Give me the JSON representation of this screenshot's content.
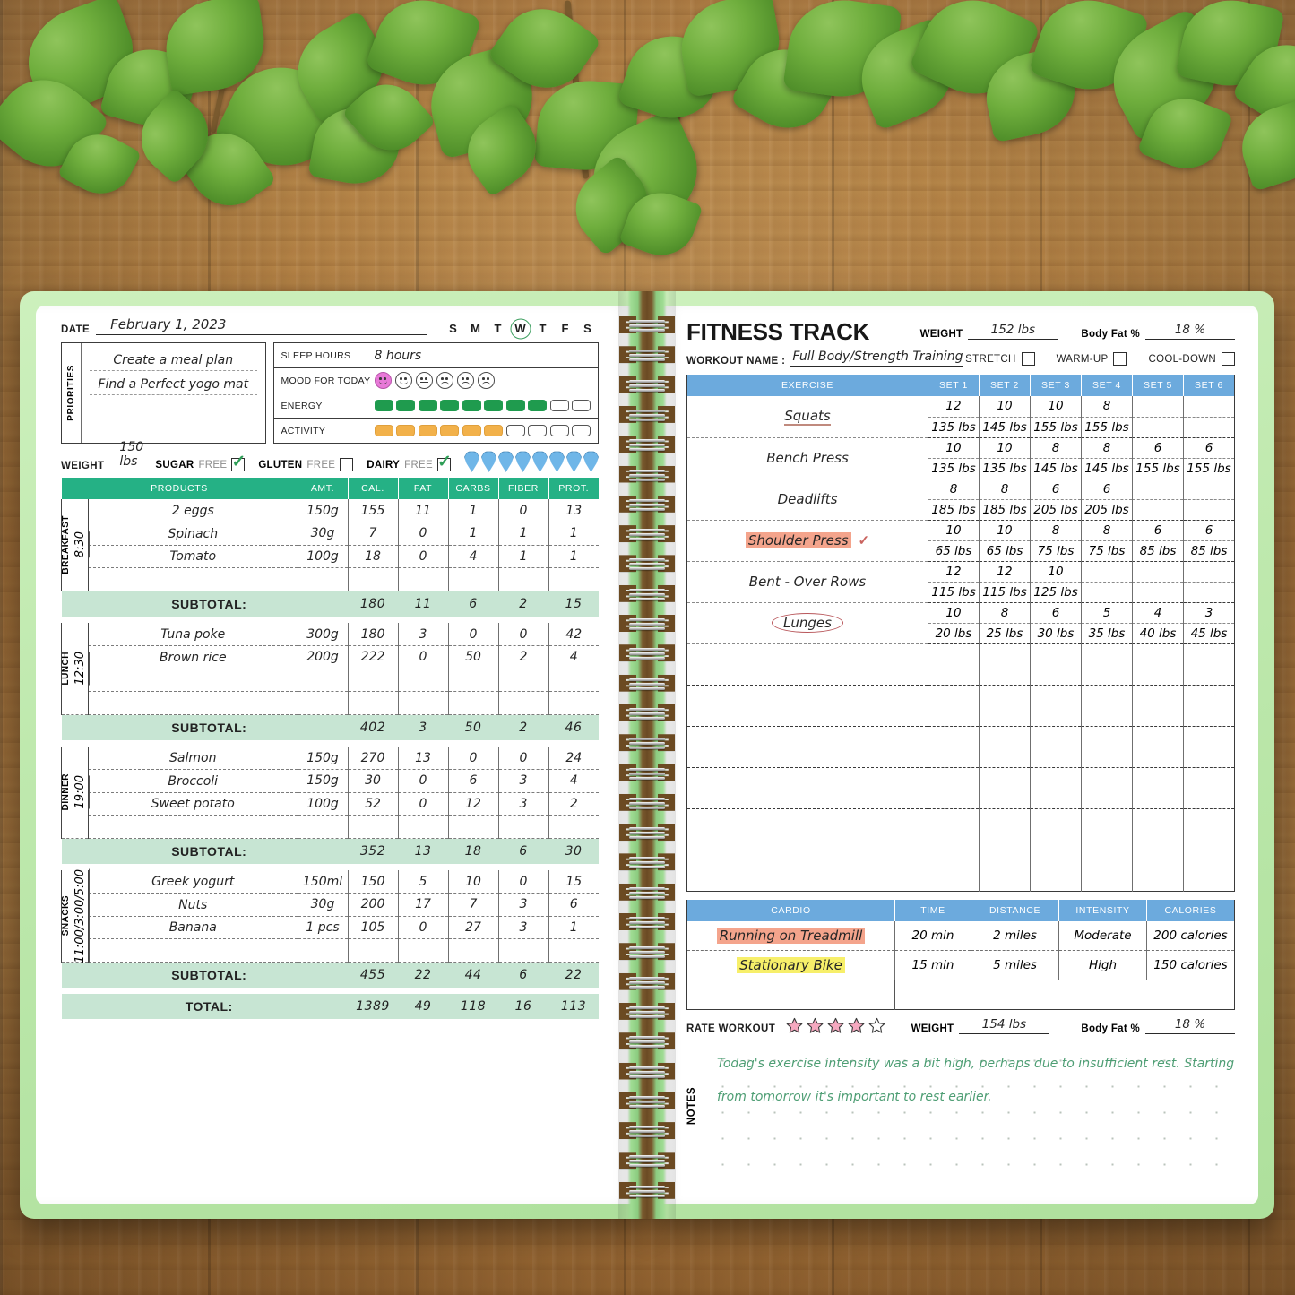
{
  "left_page": {
    "date_label": "DATE",
    "date_value": "February 1, 2023",
    "days": [
      "S",
      "M",
      "T",
      "W",
      "T",
      "F",
      "S"
    ],
    "selected_day_index": 3,
    "priorities_label": "PRIORITIES",
    "priorities": [
      "Create a meal plan",
      "Find a Perfect yogo mat"
    ],
    "sleep_label": "SLEEP HOURS",
    "sleep_value": "8 hours",
    "mood_label": "MOOD FOR TODAY",
    "mood_selected_index": 0,
    "mood_count": 6,
    "energy_label": "ENERGY",
    "energy_filled": 8,
    "energy_total": 10,
    "activity_label": "ACTIVITY",
    "activity_filled": 6,
    "activity_total": 10,
    "weight_label": "WEIGHT",
    "weight_value": "150 lbs",
    "free_items": [
      {
        "name": "SUGAR",
        "suffix": "FREE",
        "checked": true
      },
      {
        "name": "GLUTEN",
        "suffix": "FREE",
        "checked": false
      },
      {
        "name": "DAIRY",
        "suffix": "FREE",
        "checked": true
      }
    ],
    "water_drops_total": 8,
    "water_drops_filled": 8,
    "table_headers": [
      "PRODUCTS",
      "AMT.",
      "CAL.",
      "FAT",
      "CARBS",
      "FIBER",
      "PROT."
    ],
    "subtotal_label": "SUBTOTAL:",
    "total_label": "TOTAL:",
    "meals": [
      {
        "name": "BREAKFAST",
        "time": "8:30",
        "rows": 5,
        "items": [
          {
            "product": "2 eggs",
            "amt": "150g",
            "cal": "155",
            "fat": "11",
            "carbs": "1",
            "fiber": "0",
            "prot": "13"
          },
          {
            "product": "Spinach",
            "amt": "30g",
            "cal": "7",
            "fat": "0",
            "carbs": "1",
            "fiber": "1",
            "prot": "1"
          },
          {
            "product": "Tomato",
            "amt": "100g",
            "cal": "18",
            "fat": "0",
            "carbs": "4",
            "fiber": "1",
            "prot": "1"
          }
        ],
        "subtotal": {
          "cal": "180",
          "fat": "11",
          "carbs": "6",
          "fiber": "2",
          "prot": "15"
        }
      },
      {
        "name": "LUNCH",
        "time": "12:30",
        "rows": 5,
        "items": [
          {
            "product": "Tuna poke",
            "amt": "300g",
            "cal": "180",
            "fat": "3",
            "carbs": "0",
            "fiber": "0",
            "prot": "42"
          },
          {
            "product": "Brown rice",
            "amt": "200g",
            "cal": "222",
            "fat": "0",
            "carbs": "50",
            "fiber": "2",
            "prot": "4"
          }
        ],
        "subtotal": {
          "cal": "402",
          "fat": "3",
          "carbs": "50",
          "fiber": "2",
          "prot": "46"
        }
      },
      {
        "name": "DINNER",
        "time": "19:00",
        "rows": 5,
        "items": [
          {
            "product": "Salmon",
            "amt": "150g",
            "cal": "270",
            "fat": "13",
            "carbs": "0",
            "fiber": "0",
            "prot": "24"
          },
          {
            "product": "Broccoli",
            "amt": "150g",
            "cal": "30",
            "fat": "0",
            "carbs": "6",
            "fiber": "3",
            "prot": "4"
          },
          {
            "product": "Sweet potato",
            "amt": "100g",
            "cal": "52",
            "fat": "0",
            "carbs": "12",
            "fiber": "3",
            "prot": "2"
          }
        ],
        "subtotal": {
          "cal": "352",
          "fat": "13",
          "carbs": "18",
          "fiber": "6",
          "prot": "30"
        }
      },
      {
        "name": "SNACKS",
        "time": "11:00/3:00/5:00",
        "rows": 5,
        "items": [
          {
            "product": "Greek yogurt",
            "amt": "150ml",
            "cal": "150",
            "fat": "5",
            "carbs": "10",
            "fiber": "0",
            "prot": "15"
          },
          {
            "product": "Nuts",
            "amt": "30g",
            "cal": "200",
            "fat": "17",
            "carbs": "7",
            "fiber": "3",
            "prot": "6"
          },
          {
            "product": "Banana",
            "amt": "1 pcs",
            "cal": "105",
            "fat": "0",
            "carbs": "27",
            "fiber": "3",
            "prot": "1"
          }
        ],
        "subtotal": {
          "cal": "455",
          "fat": "22",
          "carbs": "44",
          "fiber": "6",
          "prot": "22"
        }
      }
    ],
    "total": {
      "cal": "1389",
      "fat": "49",
      "carbs": "118",
      "fiber": "16",
      "prot": "113"
    }
  },
  "right_page": {
    "title": "FITNESS TRACK",
    "weight_label": "WEIGHT",
    "weight_value": "152 lbs",
    "bodyfat_label": "Body Fat %",
    "bodyfat_value": "18 %",
    "workout_name_label": "WORKOUT NAME :",
    "workout_name_value": "Full Body/Strength Training",
    "checkboxes": [
      {
        "label": "STRETCH",
        "checked": false
      },
      {
        "label": "WARM-UP",
        "checked": false
      },
      {
        "label": "COOL-DOWN",
        "checked": false
      }
    ],
    "exercise_headers": [
      "EXERCISE",
      "SET 1",
      "SET 2",
      "SET 3",
      "SET 4",
      "SET 5",
      "SET 6"
    ],
    "exercises": [
      {
        "name": "Squats",
        "mark": "underline",
        "reps": [
          "12",
          "10",
          "10",
          "8",
          "",
          ""
        ],
        "weights": [
          "135 lbs",
          "145 lbs",
          "155 lbs",
          "155 lbs",
          "",
          ""
        ]
      },
      {
        "name": "Bench Press",
        "mark": "none",
        "reps": [
          "10",
          "10",
          "8",
          "8",
          "6",
          "6"
        ],
        "weights": [
          "135 lbs",
          "135 lbs",
          "145 lbs",
          "145 lbs",
          "155 lbs",
          "155 lbs"
        ]
      },
      {
        "name": "Deadlifts",
        "mark": "none",
        "reps": [
          "8",
          "8",
          "6",
          "6",
          "",
          ""
        ],
        "weights": [
          "185 lbs",
          "185 lbs",
          "205 lbs",
          "205 lbs",
          "",
          ""
        ]
      },
      {
        "name": "Shoulder Press",
        "mark": "highlight-red-check",
        "reps": [
          "10",
          "10",
          "8",
          "8",
          "6",
          "6"
        ],
        "weights": [
          "65 lbs",
          "65 lbs",
          "75 lbs",
          "75 lbs",
          "85 lbs",
          "85 lbs"
        ]
      },
      {
        "name": "Bent - Over Rows",
        "mark": "none",
        "reps": [
          "12",
          "12",
          "10",
          "",
          "",
          ""
        ],
        "weights": [
          "115 lbs",
          "115 lbs",
          "125 lbs",
          "",
          "",
          ""
        ]
      },
      {
        "name": "Lunges",
        "mark": "circled",
        "reps": [
          "10",
          "8",
          "6",
          "5",
          "4",
          "3"
        ],
        "weights": [
          "20 lbs",
          "25 lbs",
          "30 lbs",
          "35 lbs",
          "40 lbs",
          "45 lbs"
        ]
      }
    ],
    "empty_exercise_rows": 6,
    "cardio_headers": [
      "CARDIO",
      "TIME",
      "DISTANCE",
      "INTENSITY",
      "CALORIES"
    ],
    "cardio": [
      {
        "name": "Running on Treadmill",
        "highlight": "red",
        "time": "20 min",
        "distance": "2 miles",
        "intensity": "Moderate",
        "calories": "200 calories"
      },
      {
        "name": "Stationary Bike",
        "highlight": "yellow",
        "time": "15 min",
        "distance": "5 miles",
        "intensity": "High",
        "calories": "150 calories"
      }
    ],
    "rate_label": "RATE WORKOUT",
    "rating": 4,
    "rating_max": 5,
    "post_weight_label": "WEIGHT",
    "post_weight_value": "154 lbs",
    "post_bodyfat_label": "Body Fat %",
    "post_bodyfat_value": "18 %",
    "notes_label": "NOTES",
    "notes": [
      "Todag's exercise intensity was a bit high, perhaps due to insufficient rest. Starting",
      "from tomorrow it's important to rest earlier."
    ]
  },
  "colors": {
    "green_header": "#25b185",
    "green_subtotal": "#c7e5d3",
    "blue_header": "#6caadd",
    "cover_green": "#bfe9ae",
    "highlight_red": "#f4a48c",
    "highlight_yellow": "#f7ef6a",
    "star_pink": "#f5a8bf",
    "water_blue": "#6fb6e8",
    "energy_green": "#1f9b4e",
    "activity_orange": "#f2b14a",
    "mood_pink": "#e879d8",
    "notes_green": "#4e9e74"
  }
}
